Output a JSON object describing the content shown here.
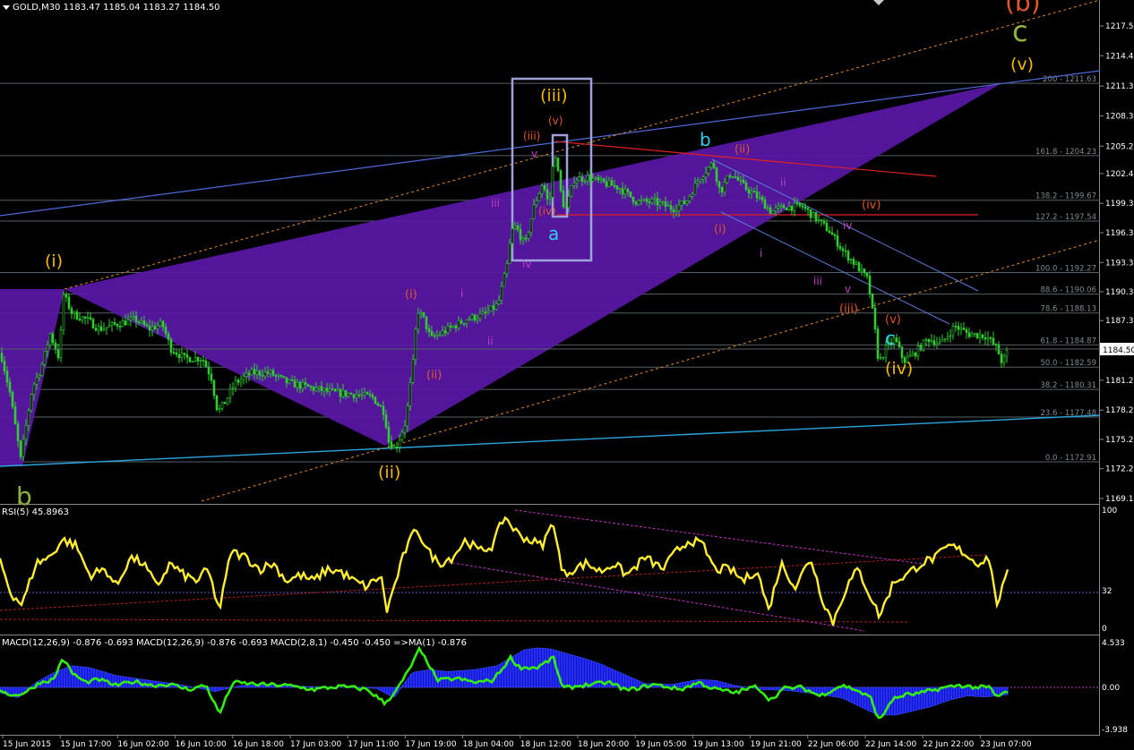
{
  "header": {
    "main": "GOLD,M30  1183.47 1185.04 1183.27 1184.50",
    "rsi": "RSI(5) 45.8963",
    "macd": "MACD(12,26,9) -0.876 -0.693  MACD(12,26,9) -0.876 -0.693  MACD(2,8,1) -0.450 -0.450  =>MA(1) -0.876"
  },
  "price_box": "1184.50",
  "chart_data": {
    "type": "candlestick",
    "symbol": "GOLD",
    "timeframe": "M30",
    "ohlc_last": {
      "open": 1183.47,
      "high": 1185.04,
      "low": 1183.27,
      "close": 1184.5
    },
    "price_axis": {
      "ylim": [
        1168.0,
        1220.2
      ],
      "ticks": [
        1217.5,
        1214.45,
        1211.35,
        1208.3,
        1205.2,
        1202.4,
        1199.35,
        1196.35,
        1193.3,
        1190.3,
        1187.35,
        1184.5,
        1181.25,
        1178.2,
        1175.2,
        1172.2,
        1169.15
      ],
      "tick_labels": [
        "1217.50",
        "1214.45",
        "1211.35",
        "1208.30",
        "1205.20",
        "1202.40",
        "1199.35",
        "1196.35",
        "1193.30",
        "1190.30",
        "1187.35",
        "1184.50",
        "1181.25",
        "1178.20",
        "1175.20",
        "1172.20",
        "1169.15"
      ]
    },
    "time_axis": [
      "15 Jun 2015",
      "15 Jun 17:00",
      "16 Jun 02:00",
      "16 Jun 10:00",
      "16 Jun 18:00",
      "17 Jun 03:00",
      "17 Jun 11:00",
      "17 Jun 19:00",
      "18 Jun 04:00",
      "18 Jun 12:00",
      "18 Jun 20:00",
      "19 Jun 05:00",
      "19 Jun 13:00",
      "19 Jun 21:00",
      "22 Jun 06:00",
      "22 Jun 14:00",
      "22 Jun 22:00",
      "23 Jun 07:00"
    ],
    "fib_levels": [
      {
        "label": "200 - 1211.63",
        "value": 1211.63
      },
      {
        "label": "161.8 - 1204.23",
        "value": 1204.23
      },
      {
        "label": "138.2 - 1199.67",
        "value": 1199.67
      },
      {
        "label": "127.2 - 1197.54",
        "value": 1197.54
      },
      {
        "label": "100.0 - 1192.27",
        "value": 1192.27
      },
      {
        "label": "88.6 - 1190.06",
        "value": 1190.06
      },
      {
        "label": "78.6 - 1188.13",
        "value": 1188.13
      },
      {
        "label": "61.8 - 1184.87",
        "value": 1184.87
      },
      {
        "label": "50.0 - 1182.59",
        "value": 1182.59
      },
      {
        "label": "38.2 - 1180.31",
        "value": 1180.31
      },
      {
        "label": "23.6 - 1177.48",
        "value": 1177.48
      },
      {
        "label": "0.0 - 1172.91",
        "value": 1172.91
      }
    ],
    "price_path": [
      [
        0,
        1184.0
      ],
      [
        10,
        1180.0
      ],
      [
        22,
        1173.2
      ],
      [
        35,
        1180.5
      ],
      [
        45,
        1182.5
      ],
      [
        55,
        1186.0
      ],
      [
        65,
        1183.5
      ],
      [
        70,
        1190.0
      ],
      [
        80,
        1188.0
      ],
      [
        95,
        1187.5
      ],
      [
        110,
        1186.5
      ],
      [
        130,
        1187.0
      ],
      [
        150,
        1187.5
      ],
      [
        165,
        1186.5
      ],
      [
        180,
        1187.0
      ],
      [
        190,
        1184.5
      ],
      [
        205,
        1183.5
      ],
      [
        225,
        1183.5
      ],
      [
        235,
        1181.5
      ],
      [
        242,
        1178.0
      ],
      [
        250,
        1179.0
      ],
      [
        262,
        1181.0
      ],
      [
        280,
        1182.0
      ],
      [
        300,
        1182.0
      ],
      [
        320,
        1181.0
      ],
      [
        345,
        1180.5
      ],
      [
        370,
        1180.0
      ],
      [
        395,
        1179.8
      ],
      [
        415,
        1179.5
      ],
      [
        428,
        1178.0
      ],
      [
        433,
        1175.0
      ],
      [
        440,
        1174.2
      ],
      [
        452,
        1177.0
      ],
      [
        460,
        1183.0
      ],
      [
        465,
        1188.5
      ],
      [
        472,
        1187.5
      ],
      [
        480,
        1185.5
      ],
      [
        490,
        1186.0
      ],
      [
        500,
        1186.5
      ],
      [
        520,
        1187.5
      ],
      [
        540,
        1188.0
      ],
      [
        555,
        1189.0
      ],
      [
        565,
        1193.0
      ],
      [
        570,
        1196.5
      ],
      [
        575,
        1197.0
      ],
      [
        585,
        1195.0
      ],
      [
        595,
        1199.0
      ],
      [
        605,
        1201.5
      ],
      [
        612,
        1199.0
      ],
      [
        618,
        1205.0
      ],
      [
        625,
        1200.5
      ],
      [
        630,
        1198.5
      ],
      [
        640,
        1201.8
      ],
      [
        655,
        1202.0
      ],
      [
        670,
        1201.5
      ],
      [
        690,
        1201.0
      ],
      [
        710,
        1199.5
      ],
      [
        730,
        1199.5
      ],
      [
        750,
        1198.8
      ],
      [
        765,
        1199.5
      ],
      [
        780,
        1202.0
      ],
      [
        795,
        1203.5
      ],
      [
        803,
        1200.5
      ],
      [
        815,
        1202.5
      ],
      [
        830,
        1201.0
      ],
      [
        845,
        1200.0
      ],
      [
        860,
        1198.5
      ],
      [
        875,
        1199.0
      ],
      [
        895,
        1199.0
      ],
      [
        910,
        1197.8
      ],
      [
        925,
        1196.5
      ],
      [
        940,
        1194.5
      ],
      [
        955,
        1193.0
      ],
      [
        968,
        1191.5
      ],
      [
        975,
        1187.0
      ],
      [
        980,
        1183.0
      ],
      [
        988,
        1184.5
      ],
      [
        998,
        1185.5
      ],
      [
        1008,
        1183.2
      ],
      [
        1020,
        1184.0
      ],
      [
        1035,
        1185.5
      ],
      [
        1050,
        1185.0
      ],
      [
        1065,
        1186.8
      ],
      [
        1080,
        1186.0
      ],
      [
        1100,
        1185.8
      ],
      [
        1112,
        1184.5
      ],
      [
        1118,
        1183.0
      ],
      [
        1125,
        1184.5
      ]
    ],
    "rsi": {
      "name": "RSI(5)",
      "value": 45.8963,
      "levels": [
        32
      ],
      "ylim": [
        0,
        100
      ],
      "tick_labels": [
        "100",
        "32",
        "0"
      ],
      "path": [
        [
          0,
          58
        ],
        [
          12,
          30
        ],
        [
          25,
          20
        ],
        [
          40,
          55
        ],
        [
          55,
          60
        ],
        [
          70,
          75
        ],
        [
          85,
          70
        ],
        [
          100,
          45
        ],
        [
          118,
          50
        ],
        [
          130,
          35
        ],
        [
          145,
          60
        ],
        [
          160,
          55
        ],
        [
          175,
          35
        ],
        [
          190,
          55
        ],
        [
          205,
          45
        ],
        [
          220,
          40
        ],
        [
          232,
          50
        ],
        [
          245,
          15
        ],
        [
          258,
          65
        ],
        [
          275,
          60
        ],
        [
          290,
          50
        ],
        [
          305,
          55
        ],
        [
          320,
          40
        ],
        [
          335,
          45
        ],
        [
          350,
          40
        ],
        [
          365,
          50
        ],
        [
          380,
          48
        ],
        [
          395,
          40
        ],
        [
          410,
          35
        ],
        [
          425,
          45
        ],
        [
          432,
          15
        ],
        [
          442,
          40
        ],
        [
          452,
          65
        ],
        [
          465,
          85
        ],
        [
          478,
          65
        ],
        [
          490,
          55
        ],
        [
          505,
          60
        ],
        [
          520,
          75
        ],
        [
          535,
          65
        ],
        [
          550,
          70
        ],
        [
          563,
          95
        ],
        [
          578,
          80
        ],
        [
          590,
          75
        ],
        [
          605,
          70
        ],
        [
          618,
          90
        ],
        [
          628,
          45
        ],
        [
          640,
          50
        ],
        [
          655,
          55
        ],
        [
          670,
          48
        ],
        [
          685,
          55
        ],
        [
          700,
          45
        ],
        [
          720,
          60
        ],
        [
          740,
          50
        ],
        [
          755,
          65
        ],
        [
          770,
          75
        ],
        [
          785,
          70
        ],
        [
          798,
          50
        ],
        [
          815,
          50
        ],
        [
          830,
          40
        ],
        [
          845,
          50
        ],
        [
          858,
          15
        ],
        [
          872,
          55
        ],
        [
          888,
          35
        ],
        [
          905,
          60
        ],
        [
          918,
          25
        ],
        [
          930,
          5
        ],
        [
          945,
          35
        ],
        [
          958,
          50
        ],
        [
          970,
          30
        ],
        [
          982,
          10
        ],
        [
          998,
          40
        ],
        [
          1012,
          45
        ],
        [
          1028,
          55
        ],
        [
          1045,
          60
        ],
        [
          1060,
          70
        ],
        [
          1075,
          65
        ],
        [
          1090,
          55
        ],
        [
          1105,
          60
        ],
        [
          1112,
          20
        ],
        [
          1120,
          35
        ],
        [
          1125,
          45.9
        ]
      ]
    },
    "macd": {
      "name": "MACD(12,26,9)",
      "values": {
        "main": -0.876,
        "signal": -0.693,
        "fast_main": -0.45,
        "fast_signal": -0.45,
        "ma": -0.876
      },
      "ylim": [
        -3.938,
        4.533
      ],
      "tick_labels": [
        "4.533",
        "0.00",
        "-3.938"
      ],
      "hist_path": [
        [
          0,
          -0.5
        ],
        [
          20,
          -1.0
        ],
        [
          40,
          0.5
        ],
        [
          60,
          1.5
        ],
        [
          80,
          2.2
        ],
        [
          100,
          2.0
        ],
        [
          130,
          1.2
        ],
        [
          160,
          0.8
        ],
        [
          200,
          0.3
        ],
        [
          240,
          -0.4
        ],
        [
          270,
          0.2
        ],
        [
          300,
          0.3
        ],
        [
          340,
          0.1
        ],
        [
          380,
          0.0
        ],
        [
          420,
          -0.1
        ],
        [
          440,
          -1.0
        ],
        [
          460,
          1.5
        ],
        [
          480,
          1.8
        ],
        [
          500,
          1.6
        ],
        [
          530,
          1.8
        ],
        [
          555,
          2.2
        ],
        [
          570,
          3.0
        ],
        [
          585,
          3.8
        ],
        [
          600,
          4.0
        ],
        [
          615,
          3.9
        ],
        [
          630,
          3.5
        ],
        [
          650,
          3.0
        ],
        [
          670,
          2.4
        ],
        [
          690,
          1.6
        ],
        [
          720,
          0.4
        ],
        [
          750,
          0.3
        ],
        [
          780,
          0.8
        ],
        [
          800,
          0.7
        ],
        [
          820,
          0.2
        ],
        [
          850,
          -0.2
        ],
        [
          880,
          -0.3
        ],
        [
          910,
          -0.6
        ],
        [
          940,
          -1.0
        ],
        [
          960,
          -1.8
        ],
        [
          980,
          -2.6
        ],
        [
          1000,
          -2.6
        ],
        [
          1020,
          -2.2
        ],
        [
          1040,
          -1.8
        ],
        [
          1060,
          -1.2
        ],
        [
          1080,
          -0.8
        ],
        [
          1100,
          -0.9
        ],
        [
          1125,
          -0.7
        ]
      ],
      "line_path": [
        [
          0,
          -0.2
        ],
        [
          15,
          -0.8
        ],
        [
          30,
          -0.4
        ],
        [
          45,
          0.5
        ],
        [
          60,
          0.8
        ],
        [
          70,
          3.0
        ],
        [
          80,
          1.5
        ],
        [
          95,
          0.5
        ],
        [
          110,
          0.8
        ],
        [
          130,
          0.2
        ],
        [
          150,
          0.6
        ],
        [
          170,
          0.2
        ],
        [
          190,
          0.3
        ],
        [
          210,
          -0.2
        ],
        [
          230,
          0.2
        ],
        [
          245,
          -2.5
        ],
        [
          260,
          0.5
        ],
        [
          290,
          0.3
        ],
        [
          320,
          0.2
        ],
        [
          350,
          -0.2
        ],
        [
          380,
          0.1
        ],
        [
          410,
          -0.2
        ],
        [
          430,
          -1.5
        ],
        [
          445,
          0.0
        ],
        [
          458,
          2.0
        ],
        [
          468,
          3.8
        ],
        [
          478,
          2.5
        ],
        [
          488,
          0.7
        ],
        [
          510,
          0.9
        ],
        [
          530,
          0.5
        ],
        [
          550,
          0.7
        ],
        [
          560,
          1.8
        ],
        [
          570,
          3.0
        ],
        [
          580,
          2.0
        ],
        [
          600,
          2.0
        ],
        [
          618,
          3.0
        ],
        [
          628,
          -0.1
        ],
        [
          650,
          0.2
        ],
        [
          680,
          0.5
        ],
        [
          700,
          -0.3
        ],
        [
          730,
          0.3
        ],
        [
          760,
          -0.2
        ],
        [
          780,
          0.5
        ],
        [
          795,
          -0.1
        ],
        [
          820,
          -0.5
        ],
        [
          845,
          0.1
        ],
        [
          860,
          -1.2
        ],
        [
          875,
          -0.1
        ],
        [
          895,
          0.0
        ],
        [
          915,
          -0.8
        ],
        [
          940,
          0.2
        ],
        [
          955,
          -0.2
        ],
        [
          972,
          -1.0
        ],
        [
          982,
          -3.2
        ],
        [
          995,
          -1.2
        ],
        [
          1010,
          -0.7
        ],
        [
          1025,
          -0.6
        ],
        [
          1050,
          -0.1
        ],
        [
          1070,
          0.2
        ],
        [
          1090,
          0.0
        ],
        [
          1105,
          0.0
        ],
        [
          1112,
          -0.9
        ],
        [
          1120,
          -0.6
        ],
        [
          1125,
          -0.4
        ]
      ]
    },
    "wave_labels": [
      {
        "text": "(i)",
        "color": "#f5b800"
      },
      {
        "text": "(ii)",
        "color": "#f5b800"
      },
      {
        "text": "(iii)",
        "color": "#f5b800"
      },
      {
        "text": "(iv)",
        "color": "#f5b800"
      },
      {
        "text": "(v)",
        "color": "#f5b800"
      },
      {
        "text": "(i)",
        "color": "#e0562a"
      },
      {
        "text": "(ii)",
        "color": "#e0562a"
      },
      {
        "text": "(iii)",
        "color": "#e0562a"
      },
      {
        "text": "(iv)",
        "color": "#e0562a"
      },
      {
        "text": "(v)",
        "color": "#e0562a"
      },
      {
        "text": "(ii)",
        "color": "#e0562a"
      },
      {
        "text": "(i)",
        "color": "#e0562a"
      },
      {
        "text": "(iv)",
        "color": "#e0562a"
      },
      {
        "text": "(iii)",
        "color": "#e0562a"
      },
      {
        "text": "(v)",
        "color": "#e0562a"
      },
      {
        "text": "i",
        "color": "#c040c0"
      },
      {
        "text": "ii",
        "color": "#c040c0"
      },
      {
        "text": "iii",
        "color": "#c040c0"
      },
      {
        "text": "iv",
        "color": "#c040c0"
      },
      {
        "text": "v",
        "color": "#c040c0"
      },
      {
        "text": "i",
        "color": "#c040c0"
      },
      {
        "text": "ii",
        "color": "#c040c0"
      },
      {
        "text": "iii",
        "color": "#c040c0"
      },
      {
        "text": "iv",
        "color": "#c040c0"
      },
      {
        "text": "v",
        "color": "#c040c0"
      },
      {
        "text": "a",
        "color": "#33ccee"
      },
      {
        "text": "b",
        "color": "#33ccee"
      },
      {
        "text": "c",
        "color": "#33ccee"
      },
      {
        "text": "b",
        "color": "#8fb340"
      },
      {
        "text": "c",
        "color": "#8fb340"
      },
      {
        "text": "(b)",
        "color": "#e0562a"
      }
    ],
    "colors": {
      "candle": "#33cc33",
      "rsi": "#ffee33",
      "macd_line": "#33ee11",
      "macd_hist": "#1010dd",
      "wedge": "#5a18a8",
      "fib": "#556066"
    }
  }
}
